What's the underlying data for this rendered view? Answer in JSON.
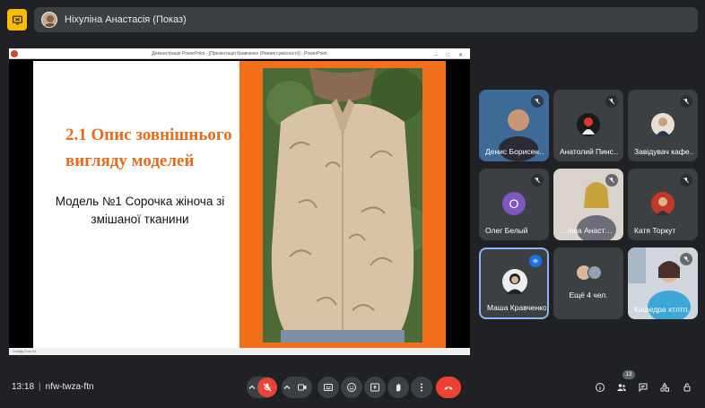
{
  "presenting": {
    "label": "Ніхуліна Анастасія (Показ)",
    "badge_color": "#fbbc04"
  },
  "powerpoint": {
    "window_title": "Демонстрація PowerPoint - [Презентація Кравченко (Режим сумісності)] - PowerPoint",
    "status": "Слайд 3 из 21"
  },
  "slide": {
    "title": "2.1 Опис зовнішнього вигляду моделей",
    "subtitle": "Модель №1  Сорочка жіноча зі змішаної тканини",
    "accent_color": "#e46c1c",
    "panel_color": "#f36f1c"
  },
  "participants": [
    {
      "name": "Денис Борисен…",
      "muted": true
    },
    {
      "name": "Анатолий Пинс…",
      "muted": true
    },
    {
      "name": "Завідувач кафе…",
      "muted": true
    },
    {
      "name": "Олег Белый",
      "initial": "О",
      "muted": true
    },
    {
      "name": "…ліна Анаст…",
      "muted": true
    },
    {
      "name": "Катя Торкут",
      "muted": true
    },
    {
      "name": "Маша Кравченко",
      "speaking": true
    },
    {
      "name": "Ещё 4 чел."
    },
    {
      "name": "Кафедра хтлтп…",
      "muted": true
    }
  ],
  "meeting": {
    "time": "13:18",
    "separator": "|",
    "code": "nfw-twza-ftn",
    "people_count": "13"
  },
  "icons": {
    "present": "present-icon",
    "mic_off": "mic-off-icon",
    "camera": "camera-icon",
    "captions": "captions-icon",
    "emoji": "emoji-icon",
    "share": "present-screen-icon",
    "raise_hand": "raise-hand-icon",
    "more": "more-vert-icon",
    "end_call": "end-call-icon",
    "info": "info-icon",
    "people": "people-icon",
    "chat": "chat-icon",
    "activities": "activities-icon",
    "host": "host-controls-icon"
  }
}
